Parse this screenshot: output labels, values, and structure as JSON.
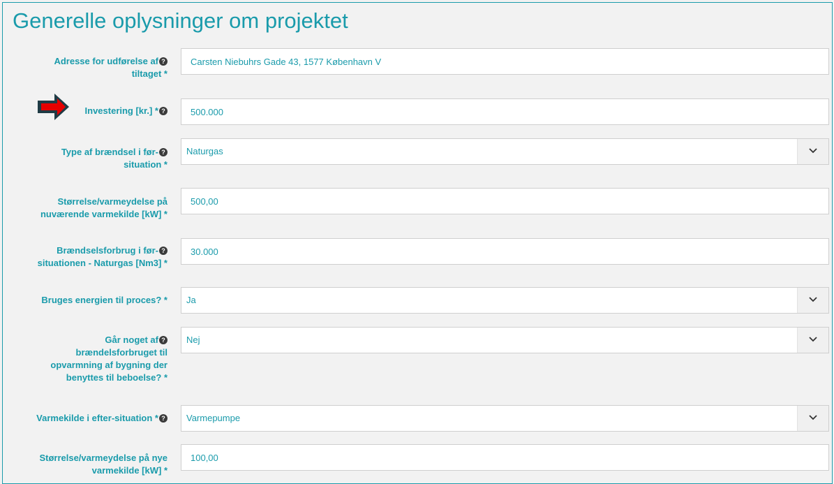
{
  "section_title": "Generelle oplysninger om projektet",
  "fields": [
    {
      "label_lines": [
        "Adresse for udførelse af",
        "tiltaget *"
      ],
      "value": "Carsten Niebuhrs Gade 43, 1577 København V"
    },
    {
      "label_lines": [
        "Investering [kr.] *"
      ],
      "value": "500.000"
    },
    {
      "label_lines": [
        "Type af brændsel i før-",
        "situation *"
      ],
      "value": "Naturgas"
    },
    {
      "label_lines": [
        "Størrelse/varmeydelse på",
        "nuværende varmekilde [kW] *"
      ],
      "value": "500,00"
    },
    {
      "label_lines": [
        "Brændselsforbrug i før-",
        "situationen - Naturgas [Nm3] *"
      ],
      "value": "30.000"
    },
    {
      "label_lines": [
        "Bruges energien til proces? *"
      ],
      "value": "Ja"
    },
    {
      "label_lines": [
        "Går noget af",
        "brændelsforbruget til",
        "opvarmning af bygning der",
        "benyttes til beboelse? *"
      ],
      "value": "Nej"
    },
    {
      "label_lines": [
        "Varmekilde i efter-situation *"
      ],
      "value": "Varmepumpe"
    },
    {
      "label_lines": [
        "Størrelse/varmeydelse på nye",
        "varmekilde [kW] *"
      ],
      "value": "100,00"
    }
  ],
  "help_icon": "question-circle-icon",
  "chevron_icon": "chevron-down-icon",
  "annotation_icon": "red-arrow-icon",
  "colors": {
    "accent": "#1a9bab",
    "background": "#f2f2f2",
    "arrow_fill": "#e60000",
    "arrow_outline": "#1f3b45"
  }
}
